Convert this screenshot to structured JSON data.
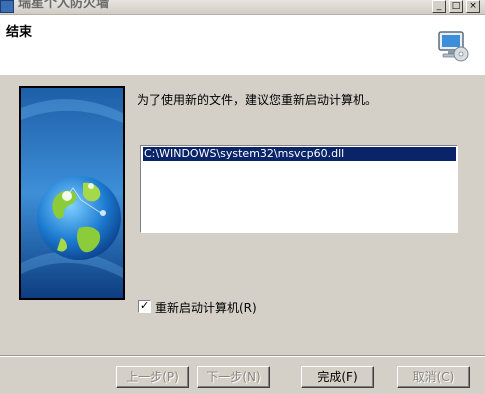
{
  "window": {
    "title": "瑞星个人防火墙",
    "minimize_glyph": "_",
    "maximize_glyph": "□",
    "close_glyph": "×"
  },
  "header": {
    "title": "结束",
    "icon": "monitor-cd-icon"
  },
  "main": {
    "instruction": "为了使用新的文件，建议您重新启动计算机。",
    "files": [
      "C:\\WINDOWS\\system32\\msvcp60.dll"
    ],
    "restart_checkbox": {
      "label": "重新启动计算机(R)",
      "checked": true,
      "check_glyph": "✓"
    }
  },
  "buttons": {
    "back": "上一步(P)",
    "next": "下一步(N)",
    "finish": "完成(F)",
    "cancel": "取消(C)"
  },
  "colors": {
    "window_bg": "#d4d0c8",
    "selection": "#0a246a"
  }
}
